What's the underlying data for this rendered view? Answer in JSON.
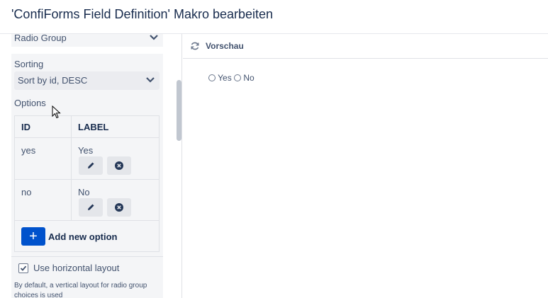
{
  "header": {
    "title": "'ConfiForms Field Definition' Makro bearbeiten"
  },
  "left": {
    "type_select": {
      "value": "Radio Group"
    },
    "sorting": {
      "label": "Sorting",
      "value": "Sort by id, DESC"
    },
    "options": {
      "label": "Options",
      "columns": [
        "ID",
        "LABEL"
      ],
      "rows": [
        {
          "id": "yes",
          "label": "Yes"
        },
        {
          "id": "no",
          "label": "No"
        }
      ],
      "add_label": "Add new option",
      "add_icon": "+"
    },
    "horizontal_layout": {
      "label": "Use horizontal layout",
      "checked": true,
      "description": "By default, a vertical layout for radio group choices is used"
    }
  },
  "preview": {
    "title": "Vorschau",
    "choices": [
      "Yes",
      "No"
    ]
  },
  "colors": {
    "accent": "#0052cc",
    "panel": "#f4f5f7"
  }
}
